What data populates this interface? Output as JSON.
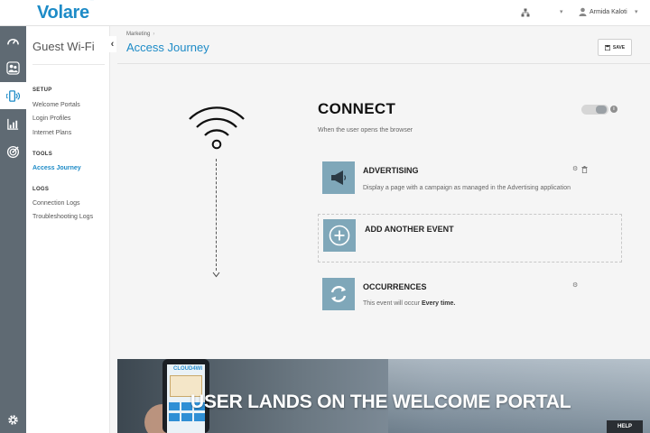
{
  "brand": {
    "name": "Volare",
    "mark": "™"
  },
  "topbar": {
    "user_name": "Armida Kaloti",
    "icons": [
      "hierarchy-icon",
      "user-icon"
    ]
  },
  "rail": {
    "items": [
      "dashboard-icon",
      "users-icon",
      "wifi-signal-icon",
      "chart-icon",
      "target-icon",
      "settings-gear-icon"
    ],
    "active": "wifi-signal-icon"
  },
  "sidenav": {
    "title": "Guest Wi-Fi",
    "sections": [
      {
        "label": "SETUP",
        "links": [
          "Welcome Portals",
          "Login Profiles",
          "Internet Plans"
        ]
      },
      {
        "label": "TOOLS",
        "links": [
          "Access Journey"
        ]
      },
      {
        "label": "LOGS",
        "links": [
          "Connection Logs",
          "Troubleshooting Logs"
        ]
      }
    ],
    "active_link": "Access Journey"
  },
  "header": {
    "breadcrumb": "Marketing",
    "breadcrumb_sep": "›",
    "title": "Access Journey",
    "save_label": "SAVE"
  },
  "journey": {
    "stage_title": "CONNECT",
    "stage_subtitle": "When the user opens the browser",
    "toggle_info": "i",
    "events": [
      {
        "title": "ADVERTISING",
        "description": "Display a page with a campaign as managed in the Advertising application",
        "icon": "megaphone-icon"
      },
      {
        "title": "ADD ANOTHER EVENT",
        "icon": "plus-circle-icon"
      },
      {
        "title": "OCCURRENCES",
        "description_prefix": "This event will occur ",
        "description_bold": "Every time.",
        "icon": "refresh-icon"
      }
    ]
  },
  "banner": {
    "text": "USER LANDS ON THE WELCOME PORTAL",
    "phone_brand": "CLOUD4WI"
  },
  "help_label": "HELP",
  "colors": {
    "accent": "#1d8bc7",
    "rail": "#5f6a73",
    "event_icon": "#7fa7b9"
  }
}
